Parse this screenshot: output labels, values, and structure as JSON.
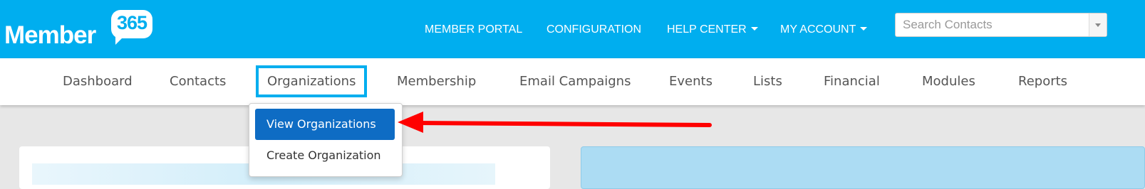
{
  "brand": {
    "name": "Member",
    "number": "365"
  },
  "topnav": {
    "member_portal": "MEMBER PORTAL",
    "configuration": "CONFIGURATION",
    "help_center": "HELP CENTER",
    "my_account": "MY ACCOUNT"
  },
  "search": {
    "placeholder": "Search Contacts"
  },
  "subnav": {
    "dashboard": "Dashboard",
    "contacts": "Contacts",
    "organizations": "Organizations",
    "membership": "Membership",
    "email_campaigns": "Email Campaigns",
    "events": "Events",
    "lists": "Lists",
    "financial": "Financial",
    "modules": "Modules",
    "reports": "Reports"
  },
  "organizations_menu": {
    "view": "View Organizations",
    "create": "Create Organization"
  },
  "colors": {
    "brand_blue": "#00aeef",
    "active_item": "#0e6cc4",
    "annotation_arrow": "#ff0000"
  }
}
